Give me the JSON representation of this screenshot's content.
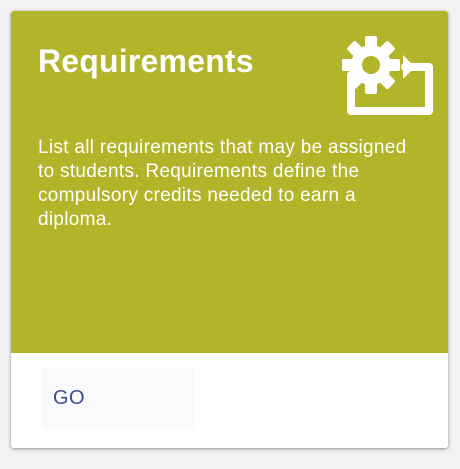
{
  "card": {
    "title": "Requirements",
    "description": "List all requirements that may be assigned to students. Requirements define the compulsory credits needed to earn a diploma.",
    "icon": "settings-applications-icon",
    "action_label": "GO"
  },
  "colors": {
    "card_header": "#b2b429",
    "button_text": "#3f4d96",
    "text_on_header": "#ffffff"
  }
}
